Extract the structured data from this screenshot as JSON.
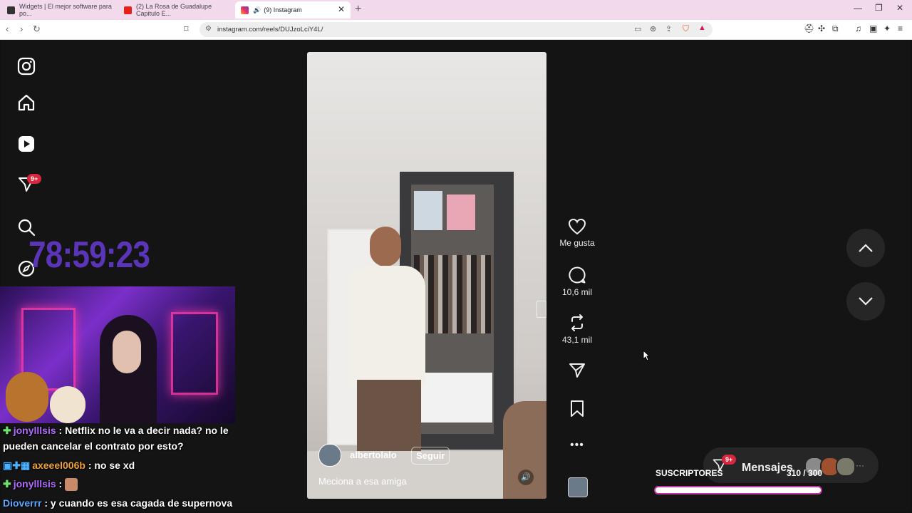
{
  "browser": {
    "tabs": [
      {
        "label": "Widgets | El mejor software para po...",
        "active": false
      },
      {
        "label": "(2) La Rosa de Guadalupe Capitulo E...",
        "active": false
      },
      {
        "label": "(9) Instagram",
        "active": true
      }
    ],
    "url": "instagram.com/reels/DUJzoLciY4L/",
    "window_controls": [
      "—",
      "❐",
      "✕"
    ]
  },
  "sidebar": {
    "notifications_badge": "9+",
    "icons": [
      "instagram-logo-icon",
      "home-icon",
      "reels-icon",
      "messages-icon",
      "search-icon",
      "explore-icon"
    ]
  },
  "overlay": {
    "timer": "78:59:23",
    "chat": [
      {
        "user": "jonylllsis",
        "text": ": Netflix no le va a decir nada? no le",
        "cont": "pueden cancelar el contrato por esto?"
      },
      {
        "user": "axeeel006b",
        "text": ": no se xd"
      },
      {
        "user": "jonylllsis",
        "text": ":"
      },
      {
        "user": "Dioverrr",
        "text": ": y cuando es esa cagada de supernova"
      }
    ],
    "subs_label": "SUSCRIPTORES",
    "subs_count": "310 / 300",
    "subs_progress": 1.03
  },
  "reel": {
    "username": "albertolalo",
    "follow_label": "Seguir",
    "caption": "Meciona a esa amiga",
    "actions": {
      "like_label": "Me gusta",
      "comments_count": "10,6 mil",
      "reposts_count": "43,1 mil"
    }
  },
  "messages": {
    "label": "Mensajes",
    "badge": "9+",
    "more": "···"
  }
}
